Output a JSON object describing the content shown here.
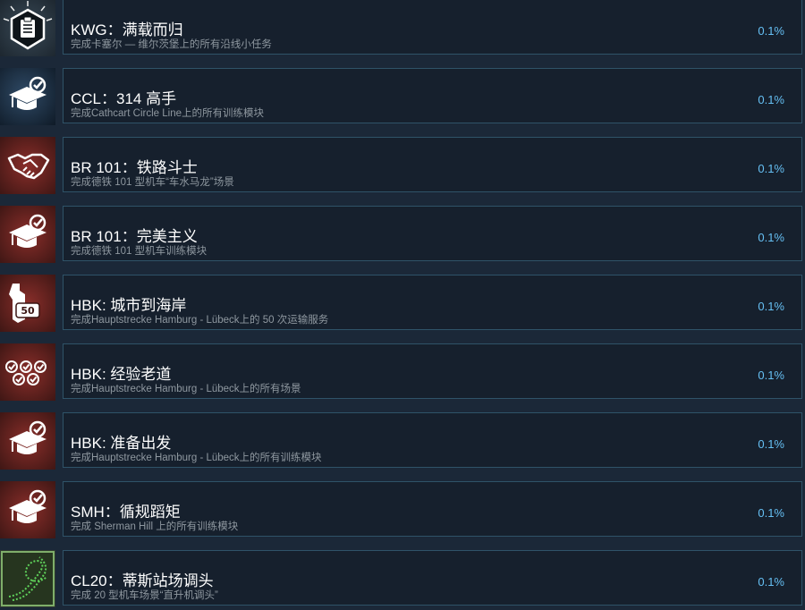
{
  "achievements": [
    {
      "title": "KWG：满载而归",
      "description": "完成卡塞尔 — 维尔茨堡上的所有沿线小任务",
      "percent": "0.1%",
      "icon": "clipboard-document-icon",
      "theme": "dark"
    },
    {
      "title": "CCL：314 高手",
      "description": "完成Cathcart Circle Line上的所有训练模块",
      "percent": "0.1%",
      "icon": "graduation-cap-check-icon",
      "theme": "blue"
    },
    {
      "title": "BR 101：铁路斗士",
      "description": "完成德铁 101 型机车“车水马龙”场景",
      "percent": "0.1%",
      "icon": "handshake-icon",
      "theme": "red"
    },
    {
      "title": "BR 101：完美主义",
      "description": "完成德铁 101 型机车训练模块",
      "percent": "0.1%",
      "icon": "graduation-cap-check-icon",
      "theme": "red"
    },
    {
      "title": "HBK: 城市到海岸",
      "description": "完成Hauptstrecke Hamburg - Lübeck上的 50 次运输服务",
      "percent": "0.1%",
      "icon": "wrench-50-icon",
      "theme": "red"
    },
    {
      "title": "HBK: 经验老道",
      "description": "完成Hauptstrecke Hamburg - Lübeck上的所有场景",
      "percent": "0.1%",
      "icon": "multiple-checks-icon",
      "theme": "red"
    },
    {
      "title": "HBK: 准备出发",
      "description": "完成Hauptstrecke Hamburg - Lübeck上的所有训练模块",
      "percent": "0.1%",
      "icon": "graduation-cap-check-icon",
      "theme": "red"
    },
    {
      "title": "SMH：循规蹈矩",
      "description": "完成 Sherman Hill 上的所有训练模块",
      "percent": "0.1%",
      "icon": "graduation-cap-check-icon",
      "theme": "red"
    },
    {
      "title": "CL20：蒂斯站场调头",
      "description": "完成 20 型机车场景“直升机调头”",
      "percent": "0.1%",
      "icon": "track-loop-icon",
      "theme": "green"
    }
  ],
  "colors": {
    "page_background": "#1b2838",
    "card_background": "#16202d",
    "card_border": "#2f5368",
    "title": "#ffffff",
    "description": "#8f98a0",
    "percent": "#66c0f4"
  }
}
